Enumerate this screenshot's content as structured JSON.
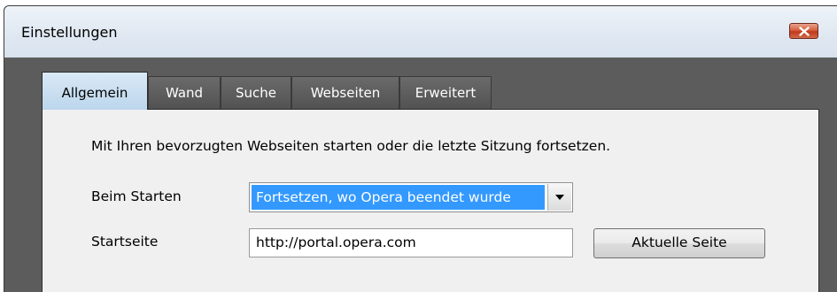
{
  "window": {
    "title": "Einstellungen"
  },
  "tabs": [
    {
      "label": "Allgemein",
      "active": true
    },
    {
      "label": "Wand",
      "active": false
    },
    {
      "label": "Suche",
      "active": false
    },
    {
      "label": "Webseiten",
      "active": false
    },
    {
      "label": "Erweitert",
      "active": false
    }
  ],
  "general": {
    "intro_text": "Mit Ihren bevorzugten Webseiten starten oder die letzte Sitzung fortsetzen.",
    "startup": {
      "label": "Beim Starten",
      "selected": "Fortsetzen, wo Opera beendet wurde"
    },
    "homepage": {
      "label": "Startseite",
      "value": "http://portal.opera.com",
      "current_page_button": "Aktuelle Seite"
    }
  },
  "colors": {
    "selection": "#3399ff",
    "close_button": "#c0391b",
    "active_tab": "#bcd6ec"
  },
  "icons": {
    "close": "close-icon",
    "dropdown": "chevron-down-icon"
  }
}
